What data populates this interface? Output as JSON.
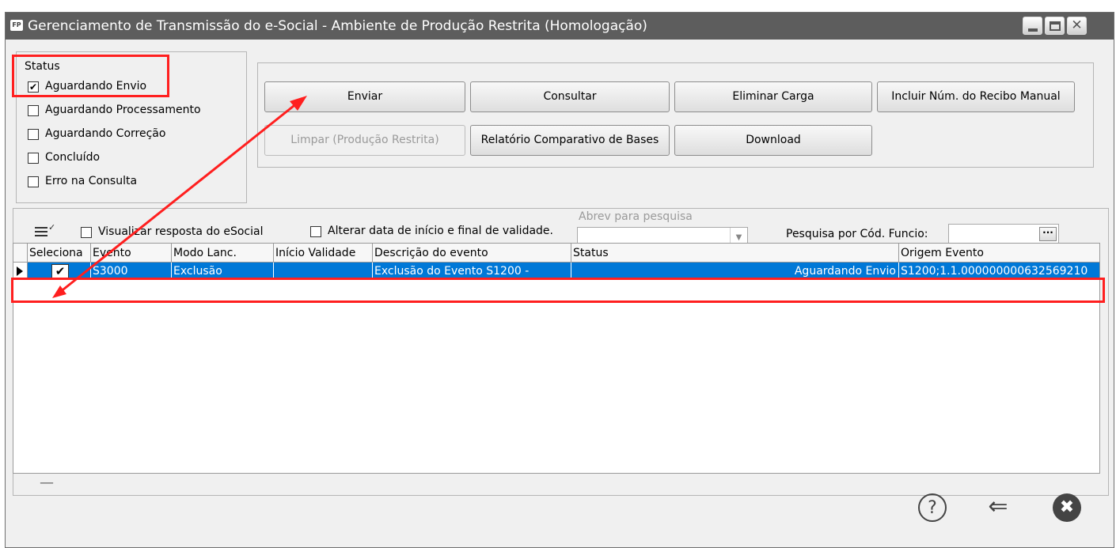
{
  "window": {
    "app_badge": "FP",
    "title": "Gerenciamento de Transmissão do e-Social - Ambiente de Produção Restrita (Homologação)",
    "title_bar_color": "#5d5d5d"
  },
  "status_group": {
    "label": "Status",
    "items": [
      {
        "label": "Aguardando Envio",
        "checked": true
      },
      {
        "label": "Aguardando Processamento",
        "checked": false
      },
      {
        "label": "Aguardando Correção",
        "checked": false
      },
      {
        "label": "Concluído",
        "checked": false
      },
      {
        "label": "Erro na Consulta",
        "checked": false
      }
    ]
  },
  "actions": {
    "enviar": "Enviar",
    "consultar": "Consultar",
    "eliminar_carga": "Eliminar Carga",
    "incluir_recibo": "Incluir Núm. do Recibo Manual",
    "limpar": "Limpar (Produção Restrita)",
    "relatorio": "Relatório Comparativo de Bases",
    "download": "Download"
  },
  "toolbar": {
    "visualizar_resposta": "Visualizar resposta do eSocial",
    "visualizar_checked": false,
    "alterar_data": "Alterar data de início e final de validade.",
    "alterar_checked": false,
    "abrev_label": "Abrev para pesquisa",
    "abrev_value": "",
    "pesquisa_label": "Pesquisa por Cód. Funcio:",
    "pesquisa_value": "",
    "ellipsis": "···"
  },
  "grid": {
    "columns": [
      "Seleciona",
      "Evento",
      "Modo Lanc.",
      "Início Validade",
      "Descrição do evento",
      "Status",
      "Origem Evento"
    ],
    "rows": [
      {
        "seleciona": true,
        "evento": "S3000",
        "modo": "Exclusão",
        "inicio": "",
        "descricao": "Exclusão do Evento S1200 -",
        "status": "Aguardando Envio",
        "origem": "S1200;1.1.000000000632569210"
      }
    ],
    "selection_color": "#0078d7",
    "footer_mark": "—"
  },
  "footer": {
    "help_icon": "?",
    "back_icon": "⇐",
    "cancel_icon": "✖"
  },
  "annotation_color": "#ff1f1f"
}
